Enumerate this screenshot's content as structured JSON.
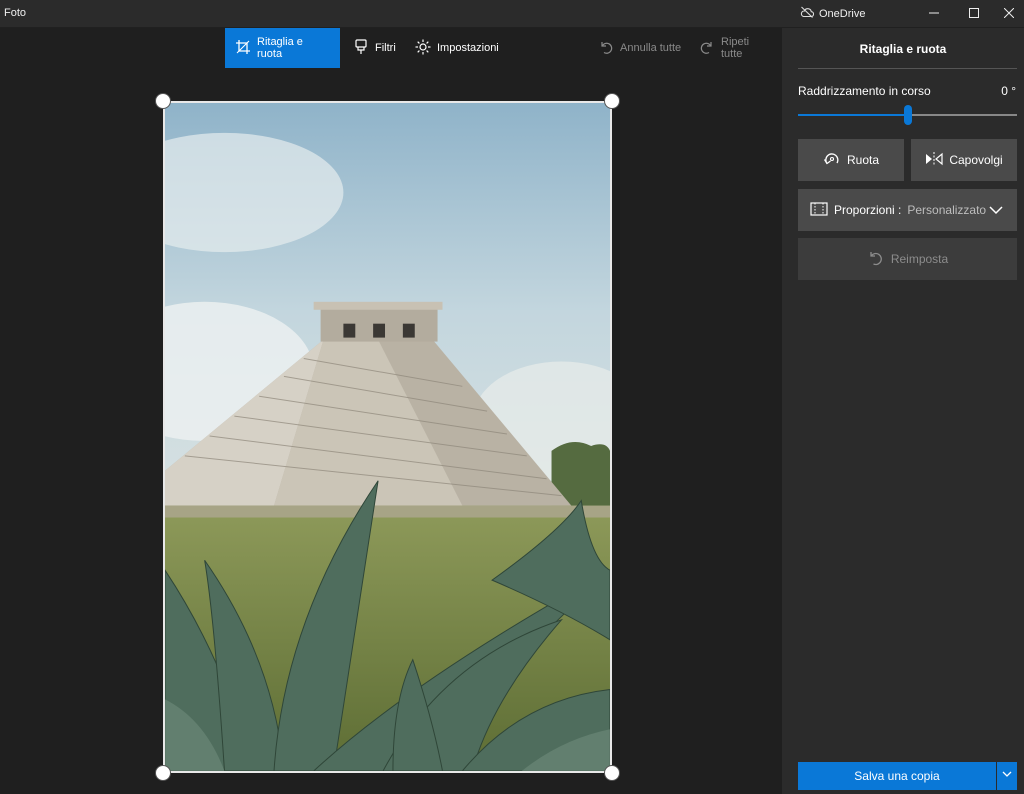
{
  "window": {
    "title": "Foto",
    "onedrive_label": "OneDrive"
  },
  "toolbar": {
    "crop_label": "Ritaglia e ruota",
    "filters_label": "Filtri",
    "settings_label": "Impostazioni",
    "undo_all_label": "Annulla tutte",
    "redo_all_label": "Ripeti tutte"
  },
  "panel": {
    "title": "Ritaglia e ruota",
    "straighten_label": "Raddrizzamento in corso",
    "straighten_value": "0 °",
    "straighten_fraction": 0.5,
    "rotate_label": "Ruota",
    "flip_label": "Capovolgi",
    "aspect_label": "Proporzioni :",
    "aspect_value": "Personalizzato",
    "reset_label": "Reimposta",
    "save_label": "Salva una copia"
  },
  "colors": {
    "accent": "#0a78d7",
    "panel_bg": "#2b2b2b",
    "canvas_bg": "#1f1f1f"
  },
  "icons": {
    "crop": "crop-icon",
    "filters": "brush-icon",
    "settings": "sun-icon",
    "undo": "undo-icon",
    "redo": "redo-icon",
    "rotate": "rotate-icon",
    "flip": "flip-icon",
    "aspect": "aspect-ratio-icon",
    "reset": "reset-icon"
  }
}
